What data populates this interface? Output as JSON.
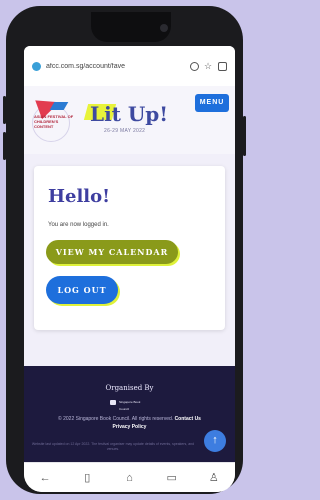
{
  "browser": {
    "url": "afcc.com.sg/account/fave"
  },
  "header": {
    "festival_name": "ASIAN FESTIVAL OF CHILDREN'S CONTENT",
    "logo_text": "Lit Up!",
    "logo_date": "26-29 MAY 2022",
    "menu_label": "MENU"
  },
  "main": {
    "greeting": "Hello!",
    "status_text": "You are now logged in.",
    "calendar_button": "VIEW MY CALENDAR",
    "logout_button": "LOG OUT"
  },
  "footer": {
    "organised_by": "Organised By",
    "sbc_logo_text": "Singapore Book Council",
    "copyright": "© 2022 Singapore Book Council. All rights reserved.",
    "contact_label": "Contact Us",
    "privacy_label": "Privacy Policy",
    "fine_print": "Website last updated on 12 Apr 2022. The festival organiser may update details of events, speakers, and venues."
  },
  "colors": {
    "primary_blue": "#1e6fdc",
    "olive_green": "#8a9a1a",
    "highlight_yellow": "#dff23a",
    "heading_purple": "#3e3ea0",
    "footer_navy": "#1d1a3e",
    "page_background": "#c9c4ea"
  },
  "icons": {
    "lock": "lock-icon",
    "tabs": "tabs-icon",
    "star": "star-icon",
    "more": "more-icon",
    "back": "back-arrow-icon",
    "bookmarks": "book-icon",
    "home": "home-icon",
    "games": "gamepad-icon",
    "profile": "profile-icon",
    "scroll_top": "arrow-up-icon"
  }
}
